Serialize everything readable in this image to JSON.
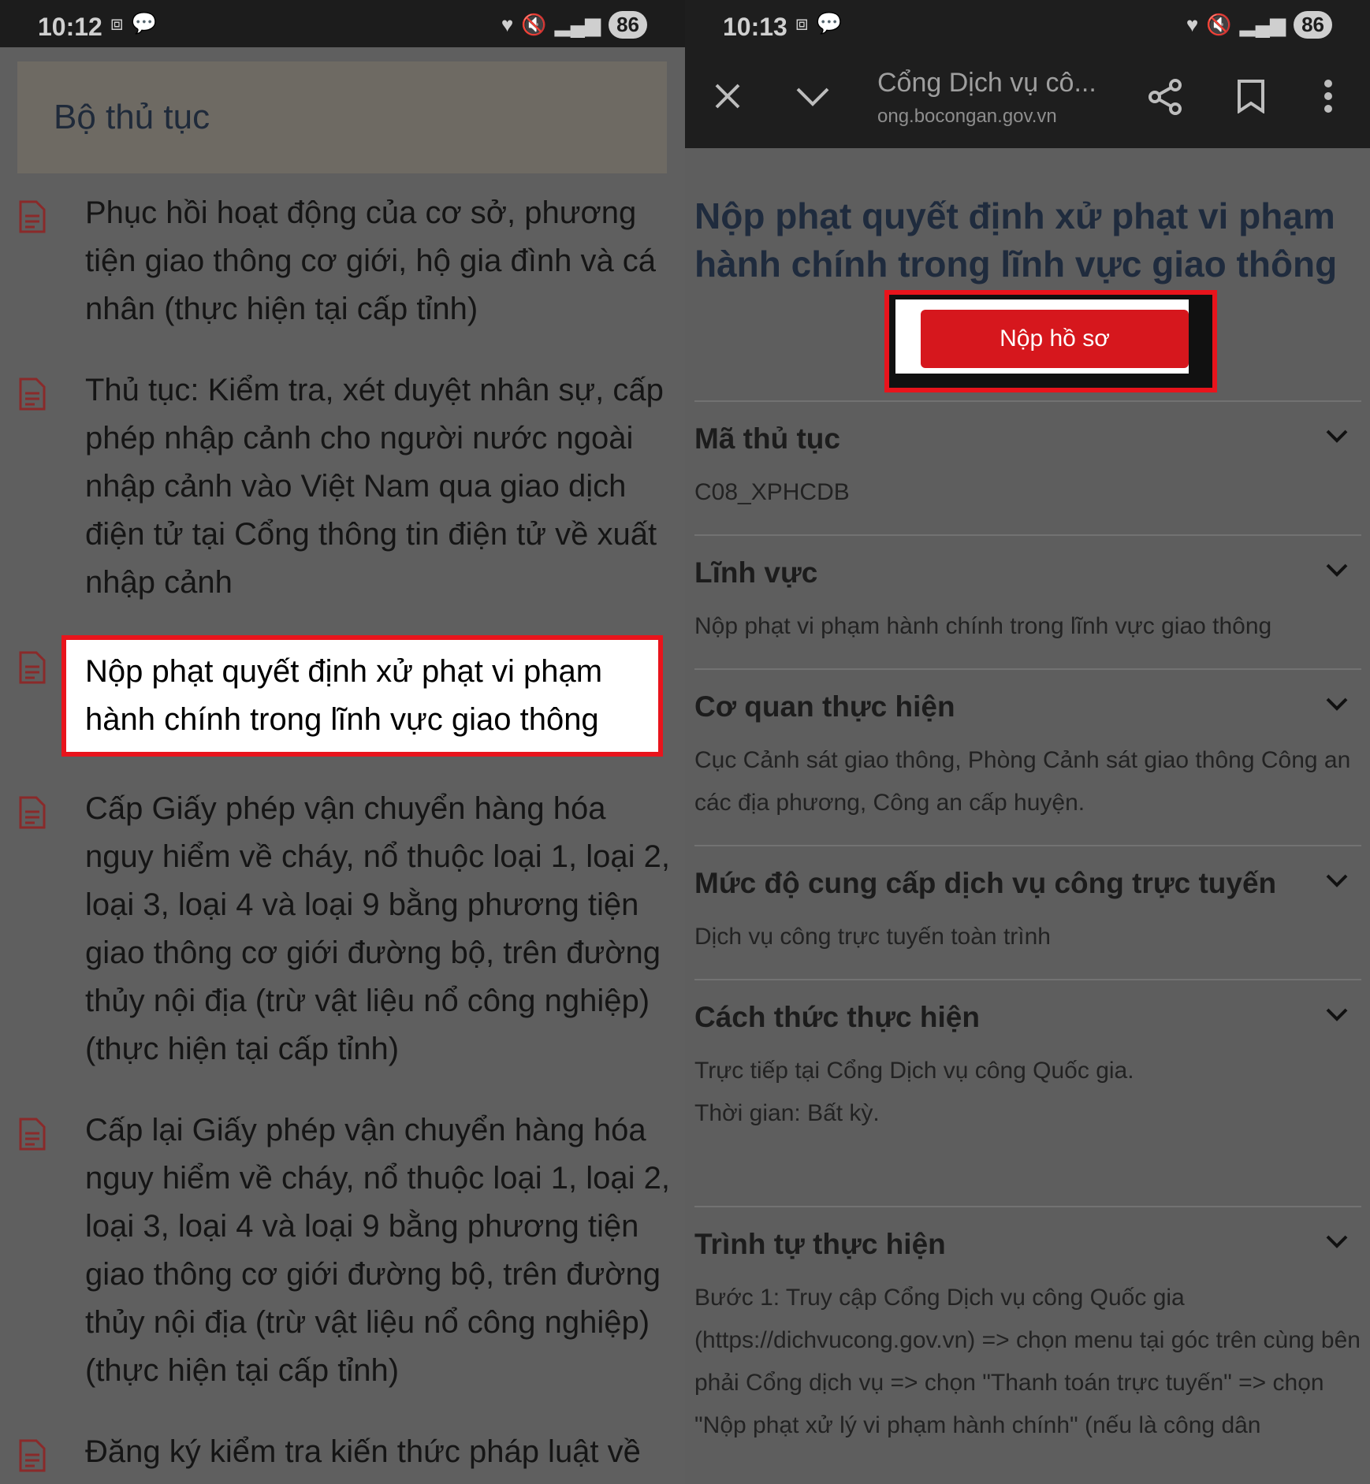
{
  "left": {
    "status": {
      "time": "10:12",
      "battery": "86"
    },
    "header_title": "Bộ thủ tục",
    "procedures": [
      "Phục hồi hoạt động của cơ sở, phương tiện giao thông cơ giới, hộ gia đình và cá nhân (thực hiện tại cấp tỉnh)",
      "Thủ tục: Kiểm tra, xét duyệt nhân sự, cấp phép nhập cảnh cho người nước ngoài nhập cảnh vào Việt Nam qua giao dịch điện tử tại Cổng thông tin điện tử về xuất nhập cảnh",
      "Nộp phạt quyết định xử phạt vi phạm hành chính trong lĩnh vực giao thông",
      "Cấp Giấy phép vận chuyển hàng hóa nguy hiểm về cháy, nổ thuộc loại 1, loại 2, loại 3, loại 4 và loại 9 bằng phương tiện giao thông cơ giới đường bộ, trên đường thủy nội địa (trừ vật liệu nổ công nghiệp) (thực hiện tại cấp tỉnh)",
      "Cấp lại Giấy phép vận chuyển hàng hóa nguy hiểm về cháy, nổ thuộc loại 1, loại 2, loại 3, loại 4 và loại 9 bằng phương tiện giao thông cơ giới đường bộ, trên đường thủy nội địa (trừ vật liệu nổ công nghiệp) (thực hiện tại cấp tỉnh)",
      "Đăng ký kiểm tra kiến thức pháp luật về"
    ]
  },
  "right": {
    "status": {
      "time": "10:13",
      "battery": "86"
    },
    "browser": {
      "title": "Cổng Dịch vụ cô...",
      "url": "ong.bocongan.gov.vn"
    },
    "detail_title": "Nộp phạt quyết định xử phạt vi phạm hành chính trong lĩnh vực giao thông",
    "submit_label": "Nộp hồ sơ",
    "sections": [
      {
        "heading": "Mã thủ tục",
        "body": "C08_XPHCDB"
      },
      {
        "heading": "Lĩnh vực",
        "body": "Nộp phạt vi phạm hành chính trong lĩnh vực giao thông"
      },
      {
        "heading": "Cơ quan thực hiện",
        "body": "Cục Cảnh sát giao thông, Phòng Cảnh sát giao thông Công an các địa phương, Công an cấp huyện."
      },
      {
        "heading": "Mức độ cung cấp dịch vụ công trực tuyến",
        "body": "Dịch vụ công trực tuyến toàn trình"
      },
      {
        "heading": "Cách thức thực hiện",
        "body": "Trực tiếp tại Cổng Dịch vụ công Quốc gia.\nThời gian: Bất kỳ."
      },
      {
        "heading": "Trình tự thực hiện",
        "body": "Bước 1: Truy cập Cổng Dịch vụ công Quốc gia (https://dichvucong.gov.vn) => chọn menu tại góc trên cùng bên phải Cổng dịch vụ => chọn \"Thanh toán trực tuyến\"  => chọn \"Nộp phạt xử lý vi phạm hành chính\" (nếu là công dân"
      }
    ]
  },
  "colors": {
    "highlight": "#e8141c",
    "button": "#d6171d",
    "overlay": "#5e5e5e"
  }
}
